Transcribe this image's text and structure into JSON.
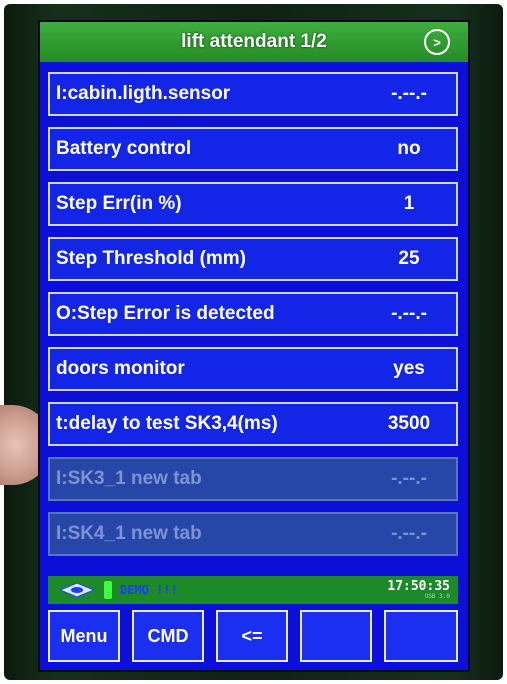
{
  "header": {
    "title": "lift attendant 1/2",
    "next_icon": ">"
  },
  "rows": [
    {
      "label": "I:cabin.ligth.sensor",
      "value": "-.--.-",
      "enabled": true
    },
    {
      "label": "Battery control",
      "value": "no",
      "enabled": true
    },
    {
      "label": "Step Err(in %)",
      "value": "1",
      "enabled": true
    },
    {
      "label": "Step Threshold (mm)",
      "value": "25",
      "enabled": true
    },
    {
      "label": "O:Step Error is detected",
      "value": "-.--.-",
      "enabled": true
    },
    {
      "label": "doors monitor",
      "value": "yes",
      "enabled": true
    },
    {
      "label": "t:delay to test SK3,4(ms)",
      "value": "3500",
      "enabled": true
    },
    {
      "label": "I:SK3_1 new tab",
      "value": "-.--.-",
      "enabled": false
    },
    {
      "label": "I:SK4_1 new tab",
      "value": "-.--.-",
      "enabled": false
    }
  ],
  "status": {
    "demo": "DEMO !!!",
    "time": "17:50:35",
    "sub": "USB 3.0"
  },
  "buttons": {
    "menu": "Menu",
    "cmd": "CMD",
    "back": "<=",
    "btn4": "",
    "btn5": ""
  },
  "colors": {
    "screen": "#0b0fd8",
    "header": "#238c23",
    "row": "#1326e8",
    "status_bar": "#1d8a2a"
  }
}
